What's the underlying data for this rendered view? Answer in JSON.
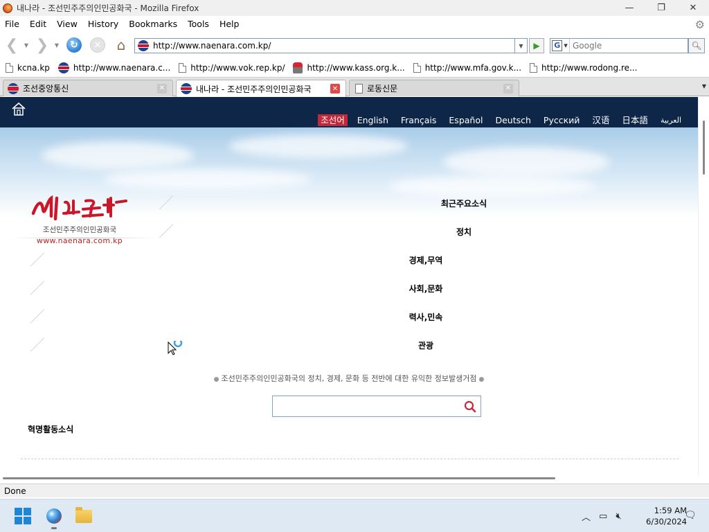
{
  "window": {
    "title": "내나라 - 조선민주주의인민공화국 - Mozilla Firefox",
    "minimize": "—",
    "restore": "❐",
    "close": "✕"
  },
  "menu": {
    "file": "File",
    "edit": "Edit",
    "view": "View",
    "history": "History",
    "bookmarks": "Bookmarks",
    "tools": "Tools",
    "help": "Help"
  },
  "nav": {
    "url": "http://www.naenara.com.kp/",
    "search_placeholder": "Google",
    "search_engine": "G"
  },
  "bookmarks_bar": [
    {
      "label": "kcna.kp",
      "icon": "page-icon"
    },
    {
      "label": "http://www.naenara.c...",
      "icon": "flag-icon"
    },
    {
      "label": "http://www.vok.rep.kp/",
      "icon": "page-icon"
    },
    {
      "label": "http://www.kass.org.k...",
      "icon": "torch-icon"
    },
    {
      "label": "http://www.mfa.gov.k...",
      "icon": "page-icon"
    },
    {
      "label": "http://www.rodong.re...",
      "icon": "page-icon"
    }
  ],
  "tabs": [
    {
      "label": "조선중앙통신",
      "active": false
    },
    {
      "label": "내나라 - 조선민주주의인민공화국",
      "active": true
    },
    {
      "label": "로동신문",
      "active": false
    }
  ],
  "site": {
    "languages": [
      "조선어",
      "English",
      "Français",
      "Español",
      "Deutsch",
      "Русский",
      "汉语",
      "日本語",
      "العربية"
    ],
    "selected_language": "조선어",
    "logo_subtitle": "조선민주주의인민공화국",
    "logo_url": "www.naenara.com.kp",
    "menu_items": [
      "최근주요소식",
      "정치",
      "경제,무역",
      "사회,문화",
      "력사,민속",
      "관광"
    ],
    "tagline": "조선민주주의인민공화국의 정치, 경제, 문화 등 전반에 대한 유익한 정보발생거점",
    "section_title": "혁명활동소식",
    "accent_color": "#c0283c",
    "header_color": "#0e2748"
  },
  "status": {
    "text": "Done"
  },
  "taskbar": {
    "time": "1:59 AM",
    "date": "6/30/2024"
  }
}
